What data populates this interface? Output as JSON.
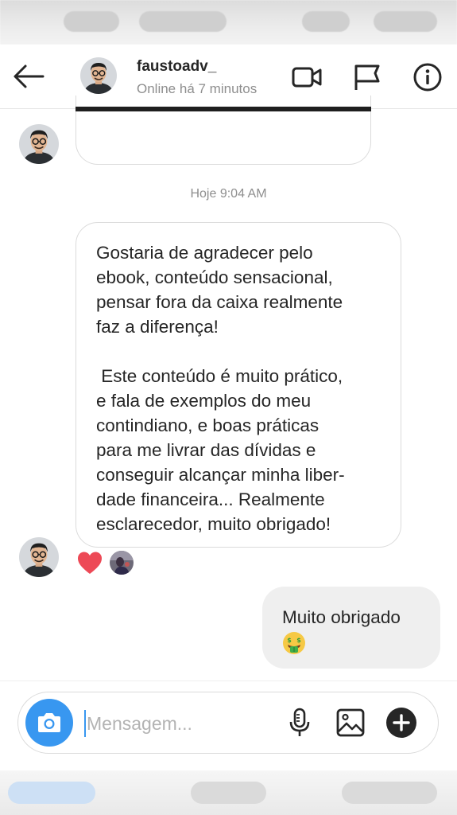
{
  "header": {
    "username": "faustoadv_",
    "presence": "Online há 7 minutos"
  },
  "thread": {
    "timestamp": "Hoje 9:04 AM",
    "incoming_message": {
      "paragraph_1_lines": [
        "Gostaria de agradecer pelo",
        "ebook, conteúdo sensacional,",
        "pensar fora da caixa realmente",
        "faz a diferença!"
      ],
      "paragraph_2_lines": [
        " Este conteúdo é muito prático,",
        "e fala de exemplos do meu",
        "contindiano, e boas práticas",
        "para me livrar das dívidas e",
        "conseguir alcançar minha liber-",
        "dade financeira... Realmente",
        "esclarecedor, muito obrigado!"
      ],
      "reaction": "heart-icon"
    },
    "outgoing_message": {
      "text": "Muito obrigado",
      "emoji": "money-mouth-face-emoji"
    }
  },
  "composer": {
    "placeholder": "Mensagem...",
    "icons": [
      "camera-icon",
      "microphone-icon",
      "gallery-icon",
      "plus-icon"
    ]
  },
  "colors": {
    "accent_blue": "#3897f0",
    "heart_red": "#ed4956",
    "outgoing_bubble": "#efefef",
    "bubble_border": "#dbdbdb",
    "secondary_text": "#8e8e8e"
  }
}
